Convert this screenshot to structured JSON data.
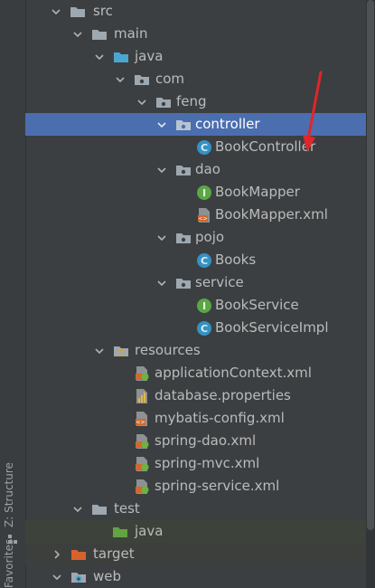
{
  "sidebar": {
    "structure_label": "Z: Structure",
    "favorites_label": "Favorites"
  },
  "tree": {
    "items": [
      {
        "label": "src"
      },
      {
        "label": "main"
      },
      {
        "label": "java"
      },
      {
        "label": "com"
      },
      {
        "label": "feng"
      },
      {
        "label": "controller"
      },
      {
        "label": "BookController"
      },
      {
        "label": "dao"
      },
      {
        "label": "BookMapper"
      },
      {
        "label": "BookMapper.xml"
      },
      {
        "label": "pojo"
      },
      {
        "label": "Books"
      },
      {
        "label": "service"
      },
      {
        "label": "BookService"
      },
      {
        "label": "BookServiceImpl"
      },
      {
        "label": "resources"
      },
      {
        "label": "applicationContext.xml"
      },
      {
        "label": "database.properties"
      },
      {
        "label": "mybatis-config.xml"
      },
      {
        "label": "spring-dao.xml"
      },
      {
        "label": "spring-mvc.xml"
      },
      {
        "label": "spring-service.xml"
      },
      {
        "label": "test"
      },
      {
        "label": "java"
      },
      {
        "label": "target"
      },
      {
        "label": "web"
      }
    ]
  },
  "colors": {
    "selection": "#4b6eaf",
    "folder_gray": "#9ea8b0",
    "folder_blue": "#4aa6cf",
    "class_icon": "#3592c4",
    "interface_icon": "#5aa745",
    "xml_icon": "#cc6a2f",
    "annotation_red": "#e0262a"
  }
}
